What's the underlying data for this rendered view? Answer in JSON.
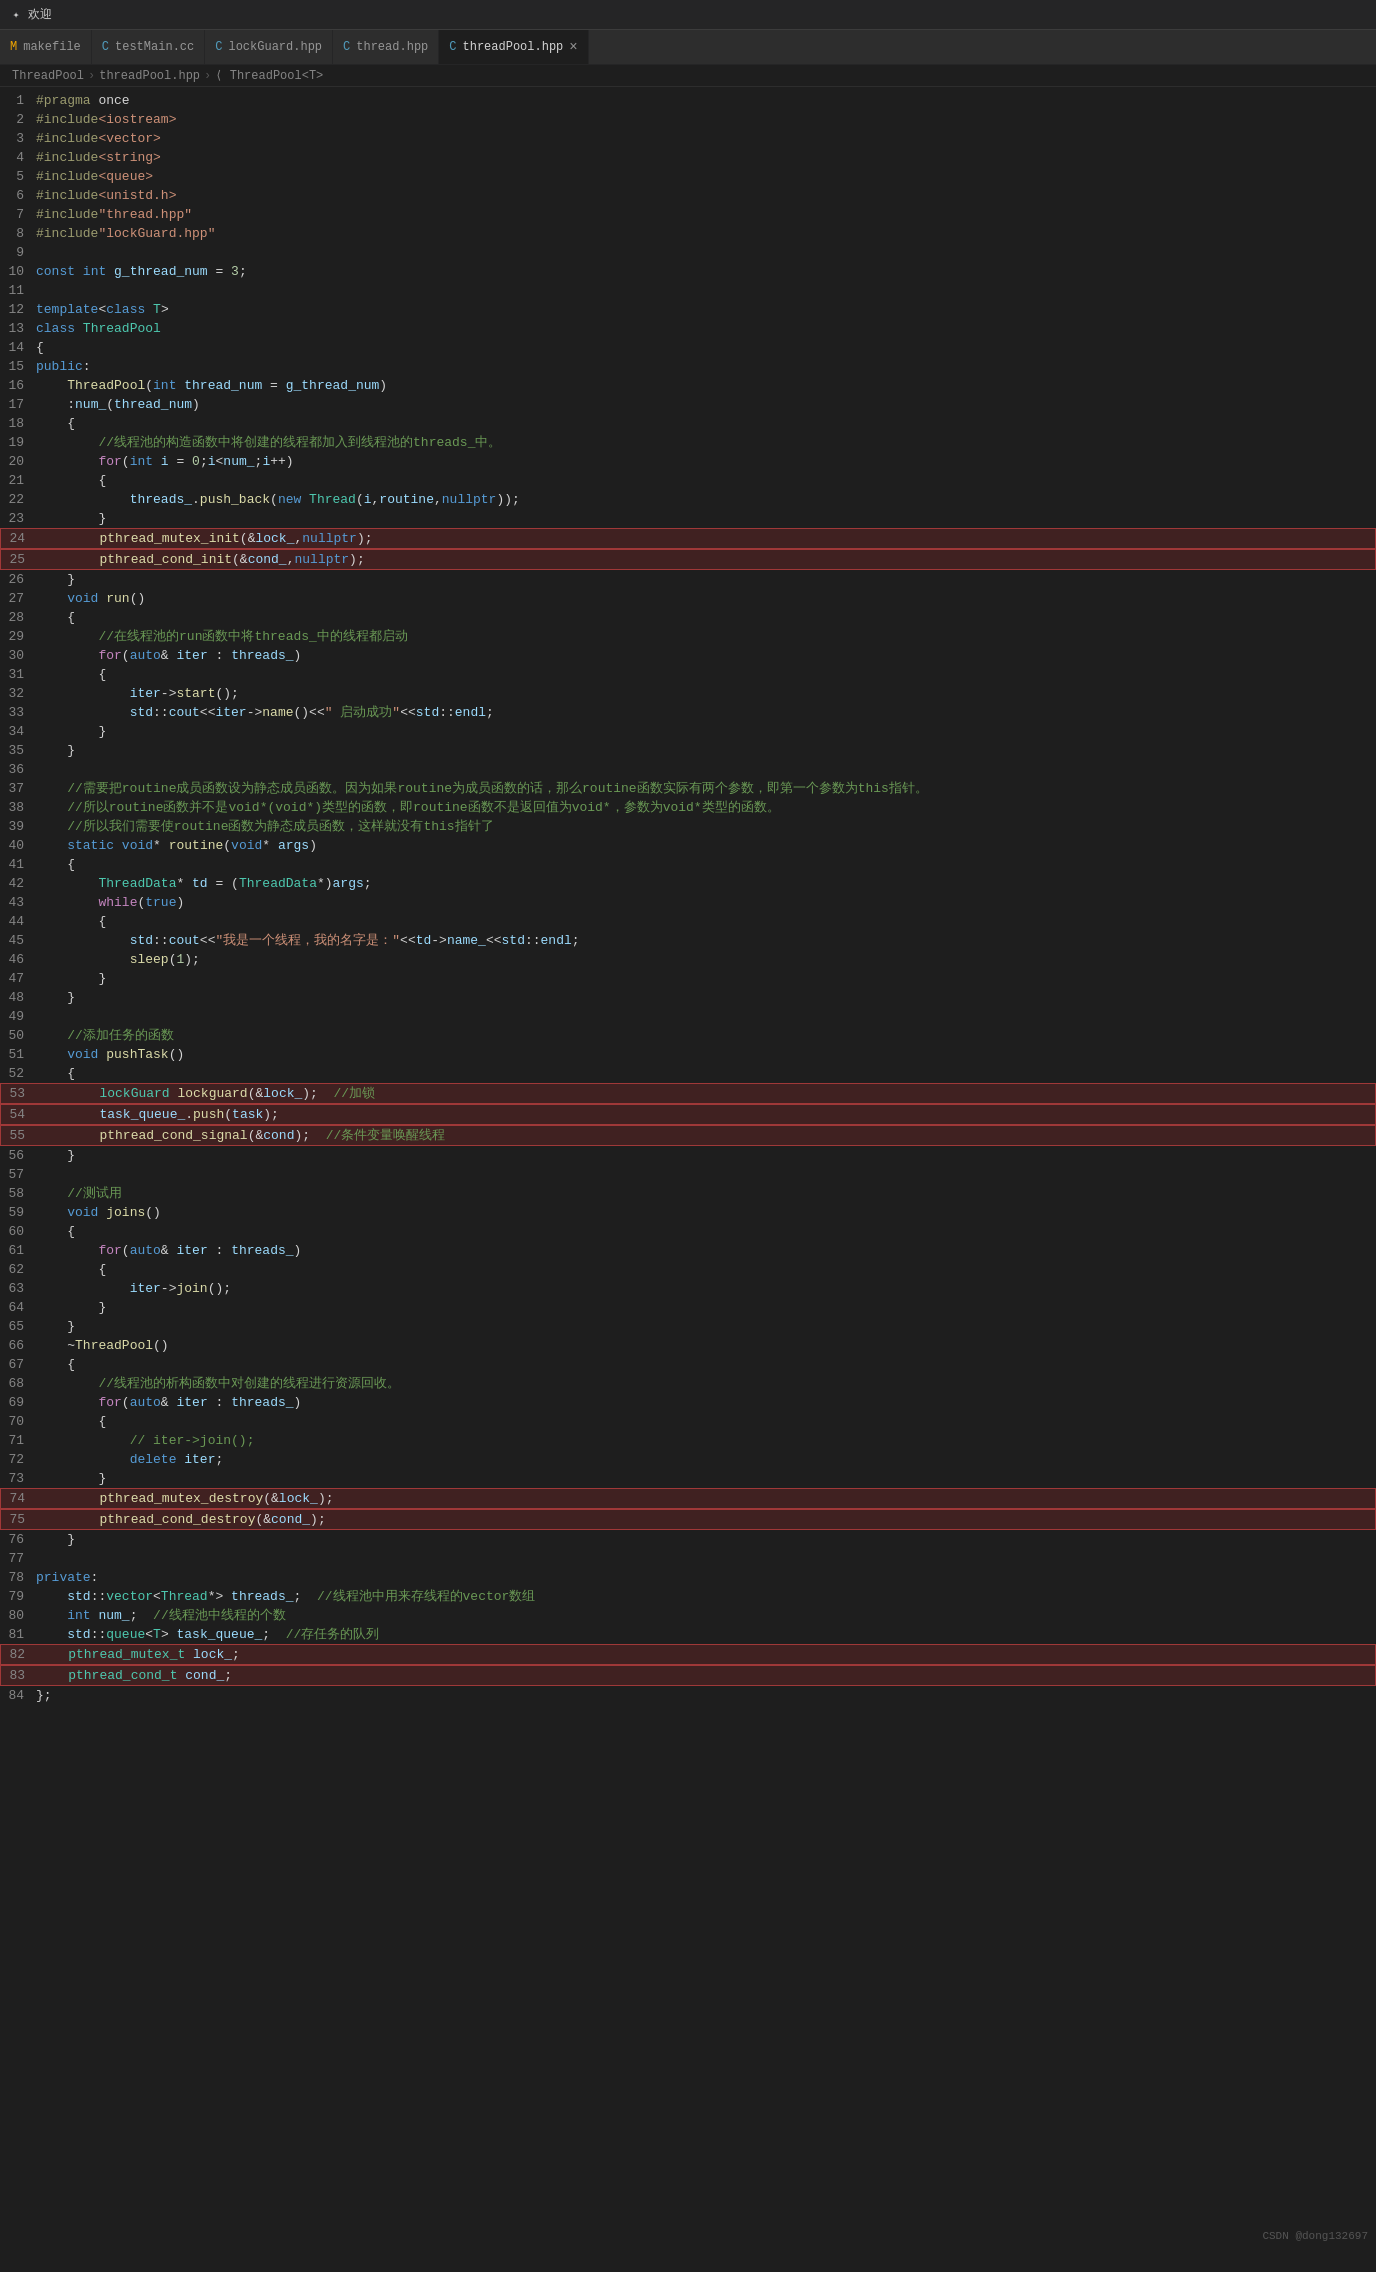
{
  "titleBar": {
    "icon": "✦",
    "text": "欢迎"
  },
  "tabs": [
    {
      "label": "makefile",
      "color": "#f0a500",
      "icon": "M",
      "active": false
    },
    {
      "label": "testMain.cc",
      "color": "#519aba",
      "icon": "C",
      "active": false
    },
    {
      "label": "lockGuard.hpp",
      "color": "#519aba",
      "icon": "C",
      "active": false
    },
    {
      "label": "thread.hpp",
      "color": "#519aba",
      "icon": "C",
      "active": false
    },
    {
      "label": "threadPool.hpp",
      "color": "#519aba",
      "icon": "C",
      "active": true
    }
  ],
  "breadcrumb": [
    "ThreadPool",
    "threadPool.hpp",
    "ThreadPool<T>"
  ],
  "watermark": "CSDN @dong132697"
}
